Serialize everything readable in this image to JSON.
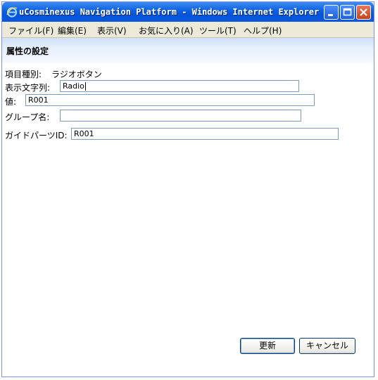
{
  "window": {
    "title": "uCosminexus Navigation Platform - Windows Internet Explorer"
  },
  "menubar": {
    "items": [
      "ファイル(F)",
      "編集(E)",
      "表示(V)",
      "お気に入り(A)",
      "ツール(T)",
      "ヘルプ(H)"
    ]
  },
  "section": {
    "title": "属性の設定"
  },
  "form": {
    "item_type_label": "項目種別:",
    "item_type_value": "ラジオボタン",
    "display_text_label": "表示文字列:",
    "display_text_value": "Radio",
    "value_label": "値:",
    "value_value": "R001",
    "group_label": "グループ名:",
    "group_value": "",
    "guide_parts_label": "ガイドパーツID:",
    "guide_parts_value": "R001"
  },
  "buttons": {
    "update": "更新",
    "cancel": "キャンセル"
  },
  "colors": {
    "titlebar": "#0553d8",
    "menubar": "#ece9d8",
    "header_gradient_top": "#cfe0fb",
    "field_border": "#7f9db9"
  },
  "icons": {
    "app": "internet-explorer-icon",
    "minimize": "minimize-icon",
    "maximize": "maximize-icon",
    "close": "close-icon"
  }
}
